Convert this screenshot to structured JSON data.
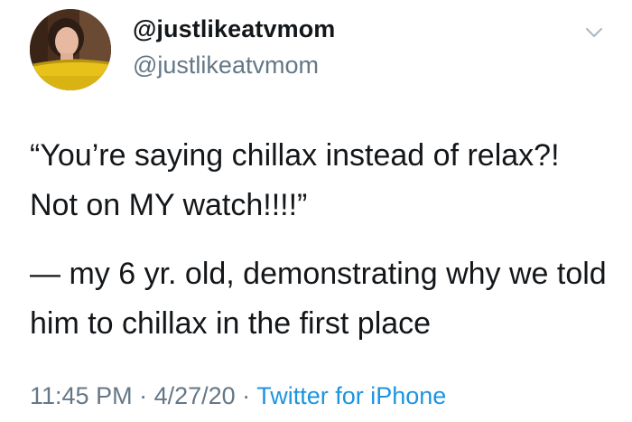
{
  "tweet": {
    "display_name": "@justlikeatvmom",
    "handle": "@justlikeatvmom",
    "text_paragraphs": [
      "“You’re saying chillax instead of relax?! Not on MY watch!!!!”",
      "— my 6 yr. old, demonstrating why we told him to chillax in the first place"
    ],
    "time": "11:45 PM",
    "separator": " · ",
    "date": "4/27/20",
    "source": "Twitter for iPhone"
  },
  "icons": {
    "menu": "chevron-down-icon",
    "avatar": "profile-photo"
  },
  "colors": {
    "text": "#14171a",
    "secondary": "#657786",
    "link": "#1b95e0"
  }
}
